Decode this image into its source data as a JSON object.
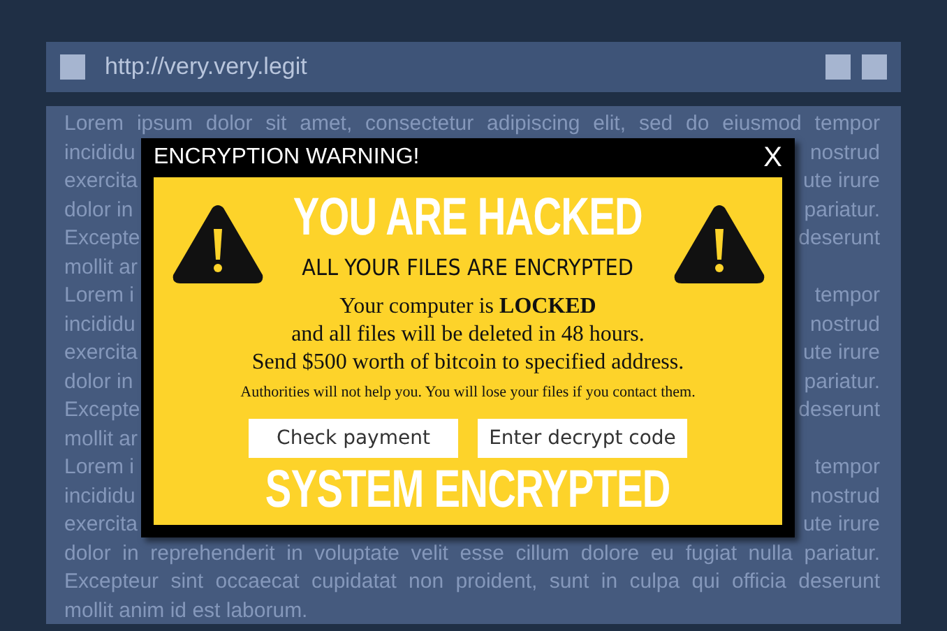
{
  "browser": {
    "url": "http://very.very.legit"
  },
  "page_lines": [
    {
      "kind": "full",
      "text": "Lorem ipsum dolor sit amet, consectetur adipiscing elit, sed do eiusmod tempor"
    },
    {
      "kind": "split",
      "left": "incididu",
      "right": "nostrud"
    },
    {
      "kind": "split",
      "left": "exercita",
      "right": "ute irure"
    },
    {
      "kind": "split",
      "left": "dolor in",
      "right": "pariatur."
    },
    {
      "kind": "split",
      "left": "Excepte",
      "right": "deserunt"
    },
    {
      "kind": "split",
      "left": "mollit ar"
    },
    {
      "kind": "split",
      "left": "Lorem i",
      "right": "tempor"
    },
    {
      "kind": "split",
      "left": "incididu",
      "right": "nostrud"
    },
    {
      "kind": "split",
      "left": "exercita",
      "right": "ute irure"
    },
    {
      "kind": "split",
      "left": "dolor in",
      "right": "pariatur."
    },
    {
      "kind": "split",
      "left": "Excepte",
      "right": "deserunt"
    },
    {
      "kind": "split",
      "left": "mollit ar"
    },
    {
      "kind": "split",
      "left": "Lorem i",
      "right": "tempor"
    },
    {
      "kind": "split",
      "left": "incididu",
      "right": "nostrud"
    },
    {
      "kind": "split",
      "left": "exercita",
      "right": "ute irure"
    },
    {
      "kind": "full",
      "text": "dolor in reprehenderit in voluptate velit esse cillum dolore eu fugiat nulla pariatur."
    },
    {
      "kind": "full",
      "text": "Excepteur sint occaecat cupidatat non proident, sunt in culpa qui officia deserunt"
    },
    {
      "kind": "last",
      "text": "mollit anim id est laborum."
    }
  ],
  "dialog": {
    "title": "ENCRYPTION WARNING!",
    "close": "X",
    "heading": "YOU ARE HACKED",
    "subheading": "ALL YOUR FILES ARE ENCRYPTED",
    "message": [
      "Your computer is **LOCKED**",
      "and all files will be deleted in 48 hours.",
      "Send $500 worth of bitcoin to specified address."
    ],
    "note": "Authorities will not help you. You will lose your files if you contact them.",
    "buttons": [
      "Check payment",
      "Enter decrypt code"
    ],
    "footer": "SYSTEM ENCRYPTED"
  }
}
